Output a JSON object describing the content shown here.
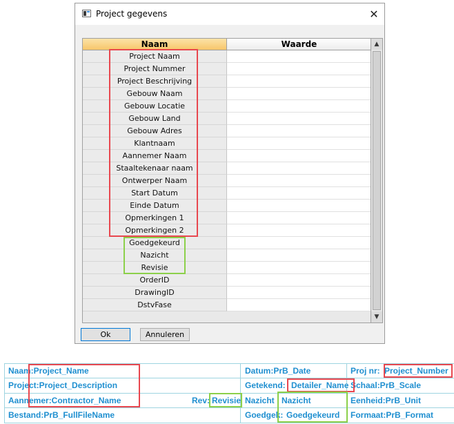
{
  "dialog": {
    "title": "Project gegevens",
    "close_glyph": "✕",
    "columns": {
      "naam": "Naam",
      "waarde": "Waarde"
    },
    "rows": [
      {
        "label": "Project Naam",
        "value": ""
      },
      {
        "label": "Project Nummer",
        "value": ""
      },
      {
        "label": "Project Beschrijving",
        "value": ""
      },
      {
        "label": "Gebouw Naam",
        "value": ""
      },
      {
        "label": "Gebouw Locatie",
        "value": ""
      },
      {
        "label": "Gebouw Land",
        "value": ""
      },
      {
        "label": "Gebouw Adres",
        "value": ""
      },
      {
        "label": "Klantnaam",
        "value": ""
      },
      {
        "label": "Aannemer Naam",
        "value": ""
      },
      {
        "label": "Staaltekenaar naam",
        "value": ""
      },
      {
        "label": "Ontwerper Naam",
        "value": ""
      },
      {
        "label": "Start Datum",
        "value": ""
      },
      {
        "label": "Einde Datum",
        "value": ""
      },
      {
        "label": "Opmerkingen 1",
        "value": ""
      },
      {
        "label": "Opmerkingen 2",
        "value": ""
      },
      {
        "label": "Goedgekeurd",
        "value": ""
      },
      {
        "label": "Nazicht",
        "value": ""
      },
      {
        "label": "Revisie",
        "value": ""
      },
      {
        "label": "OrderID",
        "value": ""
      },
      {
        "label": "DrawingID",
        "value": ""
      },
      {
        "label": "DstvFase",
        "value": ""
      }
    ],
    "scroll_up_glyph": "▲",
    "scroll_down_glyph": "▼",
    "ok_label": "Ok",
    "cancel_label": "Annuleren"
  },
  "title_block": {
    "naam": "Naam:Project_Name",
    "project": "Project:Project_Description",
    "aannemer": "Aannemer:Contractor_Name",
    "rev_label": "Rev:",
    "rev_value": "Revisie",
    "bestand": "Bestand:PrB_FullFileName",
    "datum": "Datum:PrB_Date",
    "getekend_label": "Getekend:",
    "getekend_value": "Detailer_Name",
    "nazicht_label": "Nazicht",
    "nazicht_value": "Nazicht",
    "goedgek_label": "Goedgek:",
    "goedgek_value": "Goedgekeurd",
    "proj_nr_label": "Proj nr:",
    "proj_nr_value": "Project_Number",
    "schaal": "Schaal:PrB_Scale",
    "eenheid": "Eenheid:PrB_Unit",
    "formaat": "Formaat:PrB_Format"
  },
  "colors": {
    "highlight_red": "#e8474f",
    "highlight_green": "#8cd04a",
    "title_block_text": "#1f8fd0",
    "header_accent": "#f7c66a"
  }
}
